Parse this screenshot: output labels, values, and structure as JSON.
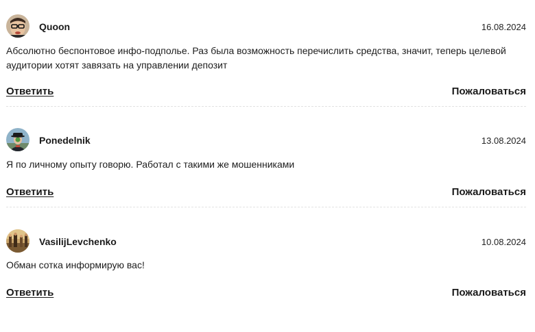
{
  "colors": {
    "text": "#1a1a1a",
    "divider": "#e2e2e2",
    "background": "#ffffff"
  },
  "comments": [
    {
      "author": "Quoon",
      "date": "16.08.2024",
      "avatar_icon": "avatar-man-with-glasses-icon",
      "text": "Абсолютно беспонтовое инфо-подполье. Раз была возможность перечислить средства, значит, теперь целевой аудитории хотят завязать на управлении депозит",
      "reply_label": "Ответить",
      "report_label": "Пожаловаться"
    },
    {
      "author": "Ponedelnik",
      "date": "13.08.2024",
      "avatar_icon": "avatar-man-in-bowler-hat-icon",
      "text": "Я по личному опыту говорю. Работал с такими же мошенниками",
      "reply_label": "Ответить",
      "report_label": "Пожаловаться"
    },
    {
      "author": "VasilijLevchenko",
      "date": "10.08.2024",
      "avatar_icon": "avatar-painting-icon",
      "text": "Обман сотка информирую вас!",
      "reply_label": "Ответить",
      "report_label": "Пожаловаться"
    }
  ]
}
